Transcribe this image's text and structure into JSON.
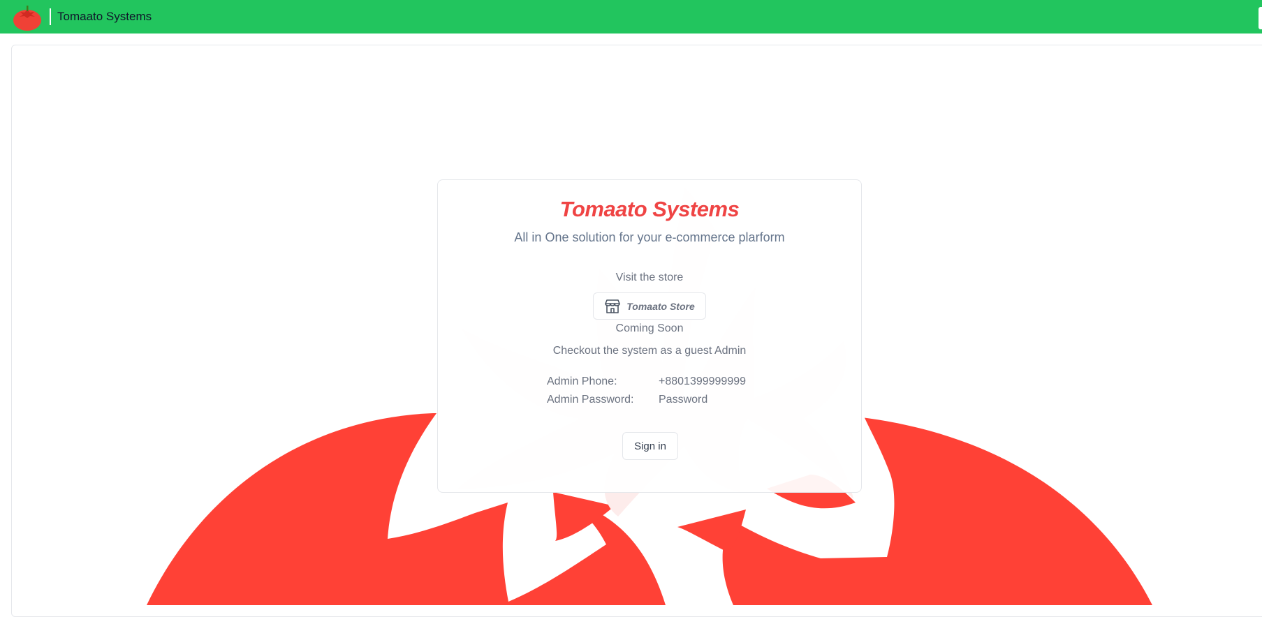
{
  "header": {
    "brand": "Tomaato Systems",
    "bg_color": "#22c55e"
  },
  "card": {
    "title": "Tomaato Systems",
    "subtitle": "All in One solution for your e-commerce plarform",
    "visit_label": "Visit the store",
    "store_button_label": "Tomaato Store",
    "coming_soon": "Coming Soon",
    "guest_note": "Checkout the system as a guest Admin",
    "credentials": [
      {
        "label": "Admin Phone:",
        "value": "+8801399999999"
      },
      {
        "label": "Admin Password:",
        "value": "Password"
      }
    ],
    "signin_label": "Sign in"
  },
  "colors": {
    "accent": "#ef4444",
    "tomato": "#ff4136",
    "watermark": "#fdeceb"
  },
  "icons": {
    "logo": "tomato-icon",
    "store": "store-icon",
    "background": "tomato-illustration"
  }
}
